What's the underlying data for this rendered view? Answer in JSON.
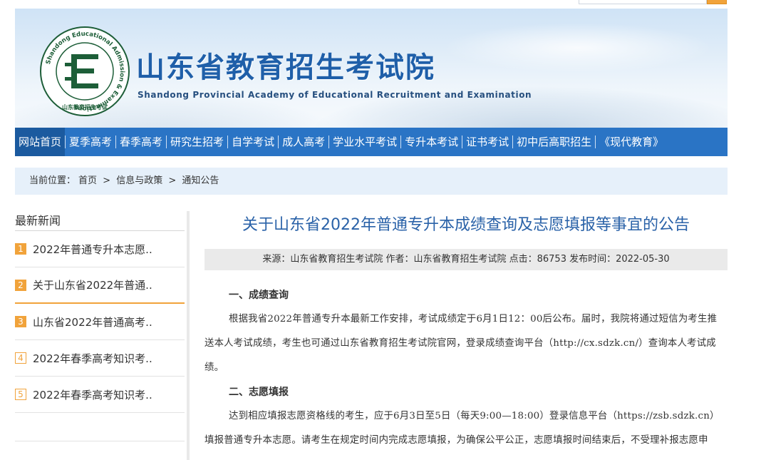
{
  "search": {
    "placeholder": ""
  },
  "header": {
    "title_cn": "山东省教育招生考试院",
    "title_en": "Shandong Provincial Academy of Educational Recruitment and Examination",
    "logo_ring_text": "Shandong Educational Admission & Examinations",
    "logo_bottom_text": "山东教育招生考试"
  },
  "nav": {
    "items": [
      {
        "label": "网站首页"
      },
      {
        "label": "夏季高考"
      },
      {
        "label": "春季高考"
      },
      {
        "label": "研究生招考"
      },
      {
        "label": "自学考试"
      },
      {
        "label": "成人高考"
      },
      {
        "label": "学业水平考试"
      },
      {
        "label": "专升本考试"
      },
      {
        "label": "证书考试"
      },
      {
        "label": "初中后高职招生"
      },
      {
        "label": "《现代教育》"
      }
    ]
  },
  "breadcrumb": {
    "prefix": "当前位置：",
    "items": [
      "首页",
      "信息与政策",
      "通知公告"
    ],
    "separator": ">"
  },
  "sidebar": {
    "title": "最新新闻",
    "items": [
      {
        "num": "1",
        "label": "2022年普通专升本志愿.."
      },
      {
        "num": "2",
        "label": "关于山东省2022年普通.."
      },
      {
        "num": "3",
        "label": "山东省2022年普通高考.."
      },
      {
        "num": "4",
        "label": "2022年春季高考知识考.."
      },
      {
        "num": "5",
        "label": "2022年春季高考知识考.."
      }
    ]
  },
  "article": {
    "title": "关于山东省2022年普通专升本成绩查询及志愿填报等事宜的公告",
    "meta": "来源：山东省教育招生考试院 作者：山东省教育招生考试院 点击：86753 发布时间：2022-05-30",
    "section1_heading": "一、成绩查询",
    "section1_text": "根据我省2022年普通专升本最新工作安排，考试成绩定于6月1日12：00后公布。届时，我院将通过短信为考生推送本人考试成绩，考生也可通过山东省教育招生考试院官网，登录成绩查询平台（http://cx.sdzk.cn/）查询本人考试成绩。",
    "section2_heading": "二、志愿填报",
    "section2_text": "达到相应填报志愿资格线的考生，应于6月3日至5日（每天9:00—18:00）登录信息平台（https://zsb.sdzk.cn）填报普通专升本志愿。请考生在规定时间内完成志愿填报，为确保公平公正，志愿填报时间结束后，不受理补报志愿申"
  },
  "colors": {
    "nav_bg": "#2a74c5",
    "nav_active": "#1b5a9f",
    "title_blue": "#2a62a8",
    "accent_orange": "#f1a33b",
    "crumb_bg": "#e6f0fa"
  }
}
